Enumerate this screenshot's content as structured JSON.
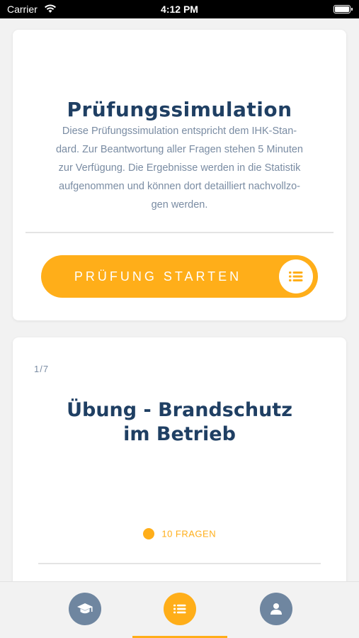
{
  "status_bar": {
    "carrier": "Carrier",
    "time": "4:12 PM",
    "icons": [
      "wifi-icon",
      "battery-icon"
    ]
  },
  "exam_card": {
    "title": "Prüfungssimulation",
    "description_lines": [
      "Diese Prüfungssimulation entspricht dem IHK-Stan-",
      "dard. Zur Beantwortung aller Fragen stehen 5 Minuten",
      "zur Verfügung. Die Ergebnisse werden in die Statistik",
      "aufgenommen und können dort detailliert nachvollzo-",
      "gen werden."
    ],
    "start_button_label": "PRÜFUNG STARTEN",
    "start_button_icon": "list-icon"
  },
  "practice_card": {
    "counter": "1/7",
    "title_line1": "Übung - Brandschutz",
    "title_line2": "im Betrieb",
    "question_count": "10 FRAGEN"
  },
  "tab_bar": {
    "tabs": [
      {
        "icon": "graduation-cap-icon",
        "active": false
      },
      {
        "icon": "list-icon",
        "active": true
      },
      {
        "icon": "user-icon",
        "active": false
      }
    ],
    "accent_color": "#ffae19",
    "inactive_color": "#6f86a0"
  },
  "colors": {
    "title": "#1f3f63",
    "body_text": "#7a8ca3",
    "accent": "#ffae19",
    "background": "#f2f2f2"
  }
}
